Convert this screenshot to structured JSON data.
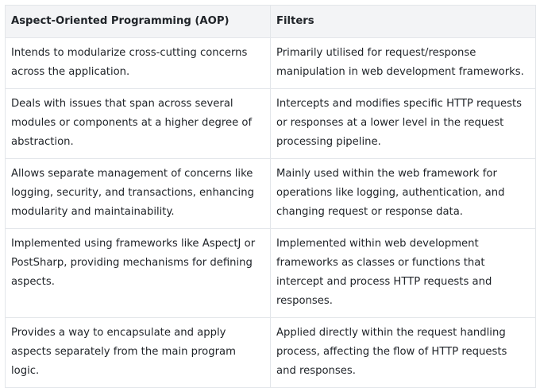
{
  "table": {
    "headers": [
      "Aspect-Oriented Programming (AOP)",
      "Filters"
    ],
    "rows": [
      [
        "Intends to modularize cross-cutting concerns across the application.",
        "Primarily utilised for request/response manipulation in web development frameworks."
      ],
      [
        "Deals with issues that span across several modules or components at a higher degree of abstraction.",
        "Intercepts and modifies specific HTTP requests or responses at a lower level in the request processing pipeline."
      ],
      [
        "Allows separate management of concerns like logging, security, and transactions, enhancing modularity and maintainability.",
        "Mainly used within the web framework for operations like logging, authentication, and changing request or response data."
      ],
      [
        "Implemented using frameworks like AspectJ or PostSharp, providing mechanisms for defining aspects.",
        "Implemented within web development frameworks as classes or functions that intercept and process HTTP requests and responses."
      ],
      [
        "Provides a way to encapsulate and apply aspects separately from the main program logic.",
        "Applied directly within the request handling process, affecting the flow of HTTP requests and responses."
      ]
    ]
  }
}
